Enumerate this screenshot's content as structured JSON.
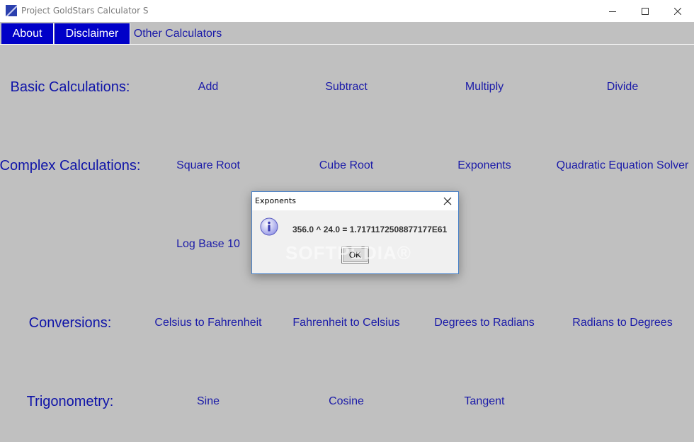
{
  "window": {
    "title": "Project GoldStars Calculator S",
    "controls": [
      "minimize",
      "maximize",
      "close"
    ]
  },
  "menu": {
    "items": [
      {
        "label": "About",
        "active": true
      },
      {
        "label": "Disclaimer",
        "active": true
      },
      {
        "label": "Other Calculators",
        "active": false
      }
    ]
  },
  "sections": {
    "basic": {
      "label": "Basic Calculations:",
      "buttons": [
        "Add",
        "Subtract",
        "Multiply",
        "Divide"
      ]
    },
    "complex": {
      "label": "Complex Calculations:",
      "buttons": [
        "Square Root",
        "Cube Root",
        "Exponents",
        "Quadratic Equation Solver",
        "Log Base 10"
      ]
    },
    "conversions": {
      "label": "Conversions:",
      "buttons": [
        "Celsius to Fahrenheit",
        "Fahrenheit to Celsius",
        "Degrees to Radians",
        "Radians to Degrees"
      ]
    },
    "trig": {
      "label": "Trigonometry:",
      "buttons": [
        "Sine",
        "Cosine",
        "Tangent"
      ]
    }
  },
  "dialog": {
    "title": "Exponents",
    "message": "356.0 ^ 24.0 = 1.7171172508877177E61",
    "ok_label": "OK",
    "icon": "info-icon"
  },
  "watermark": "SOFTPEDIA®",
  "colors": {
    "background": "#c0c0c0",
    "menu_active": "#0000c8",
    "link_text": "#1a1aa8",
    "dialog_border": "#4a82c8"
  }
}
